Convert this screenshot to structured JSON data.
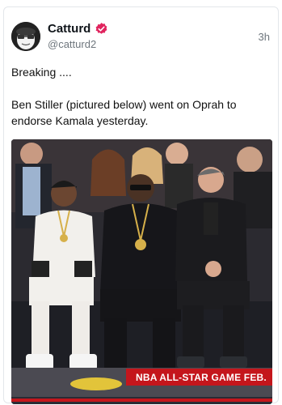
{
  "post": {
    "author_name": "Catturd",
    "author_handle": "@catturd2",
    "timestamp": "3h",
    "text_line1": "Breaking ....",
    "text_body": "Ben Stiller (pictured below) went on Oprah to endorse Kamala yesterday.",
    "photo": {
      "banner_text": "NBA ALL-STAR GAME FEB."
    }
  },
  "colors": {
    "verified_badge": "#e0245e",
    "banner": "#c4161c",
    "meta_text": "#6e767d"
  },
  "icons": {
    "avatar": "cartoon-avatar",
    "verified": "verified-badge-icon"
  }
}
